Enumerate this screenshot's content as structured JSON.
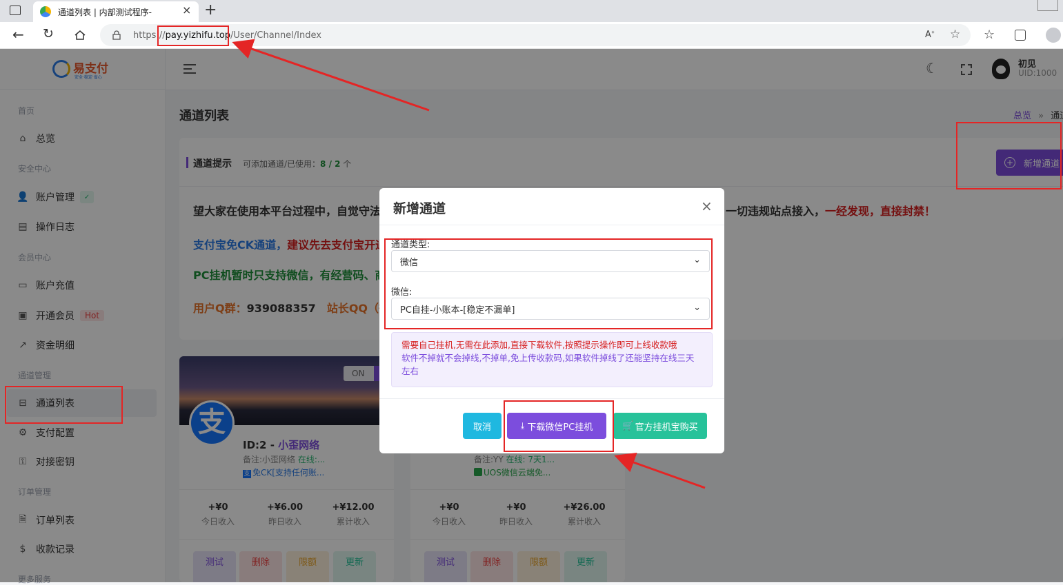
{
  "browser": {
    "tab_title": "通道列表 | 内部测试程序-",
    "url_prefix": "https://",
    "url_domain": "pay.yizhifu.top",
    "url_path": "/User/Channel/Index",
    "new_tab": "+"
  },
  "logo": {
    "text": "易支付",
    "slogan": "安全·稳定·省心"
  },
  "sidebar": {
    "sections": [
      {
        "label": "首页"
      },
      {
        "label": "安全中心"
      },
      {
        "label": "会员中心"
      },
      {
        "label": "通道管理"
      },
      {
        "label": "订单管理"
      },
      {
        "label": "更多服务"
      }
    ],
    "items": [
      {
        "label": "总览",
        "icon": "home-icon"
      },
      {
        "label": "账户管理",
        "icon": "user-icon"
      },
      {
        "label": "操作日志",
        "icon": "log-icon"
      },
      {
        "label": "账户充值",
        "icon": "wallet-icon"
      },
      {
        "label": "开通会员",
        "icon": "vip-icon",
        "badge": "Hot"
      },
      {
        "label": "资金明细",
        "icon": "chart-icon"
      },
      {
        "label": "通道列表",
        "icon": "drive-icon"
      },
      {
        "label": "支付配置",
        "icon": "settings-icon"
      },
      {
        "label": "对接密钥",
        "icon": "key-icon"
      },
      {
        "label": "订单列表",
        "icon": "file-icon"
      },
      {
        "label": "收款记录",
        "icon": "money-icon"
      }
    ]
  },
  "topbar": {
    "username": "初见",
    "uid": "UID:1000"
  },
  "page": {
    "title": "通道列表",
    "breadcrumb_home": "总览",
    "breadcrumb_sep": "»",
    "breadcrumb_current": "通道",
    "add_button": "新增通道"
  },
  "notice": {
    "title": "通道提示",
    "sub_prefix": "可添加通道/已使用：",
    "sub_count": "8 / 2",
    "sub_suffix": " 个",
    "line1_a": "望大家在使用本平台过程中，自觉守法",
    "line1_b": "一切违规站点接入，",
    "line1_c": "一经发现，直接封禁！",
    "line2_a": "支付宝免CK通道，",
    "line2_b": "建议先去支付宝开通",
    "line3": "PC挂机暂时只支持微信，有经营码、商",
    "line4_a": "用户Q群：",
    "line4_b": "939088357",
    "line4_c": "站长QQ（微"
  },
  "channel_cards": [
    {
      "switch": "ON",
      "id": "ID:2 - ",
      "name": "小歪网络",
      "note_label": "备注:小歪网络 ",
      "status": "在线:...",
      "tag": "免CK[支持任何账...",
      "stats": [
        {
          "value": "+¥0",
          "label": "今日收入"
        },
        {
          "value": "+¥6.00",
          "label": "昨日收入"
        },
        {
          "value": "+¥12.00",
          "label": "累计收入"
        }
      ],
      "actions": [
        "测试",
        "删除",
        "限额",
        "更新"
      ]
    },
    {
      "note_label": "备注:YY ",
      "status": "在线: 7天1...",
      "tag": "UOS微信云端免...",
      "stats": [
        {
          "value": "+¥0",
          "label": "今日收入"
        },
        {
          "value": "+¥0",
          "label": "昨日收入"
        },
        {
          "value": "+¥26.00",
          "label": "累计收入"
        }
      ],
      "actions": [
        "测试",
        "删除",
        "限额",
        "更新"
      ]
    }
  ],
  "modal": {
    "title": "新增通道",
    "close": "×",
    "type_label": "通道类型:",
    "type_value": "微信",
    "wechat_label": "微信:",
    "wechat_value": "PC自挂-小账本-[稳定不漏单]",
    "tip_red": "需要自己挂机,无需在此添加,直接下载软件,按照提示操作即可上线收款哦",
    "tip_purple": "软件不掉就不会掉线,不掉单,免上传收款码,如果软件掉线了还能坚持在线三天左右",
    "cancel": "取消",
    "download": "下载微信PC挂机",
    "buy": "官方挂机宝购买"
  },
  "colors": {
    "accent": "#7c4ddd",
    "cyan": "#1fb8e0",
    "green": "#27c29a",
    "red": "#e42525"
  }
}
